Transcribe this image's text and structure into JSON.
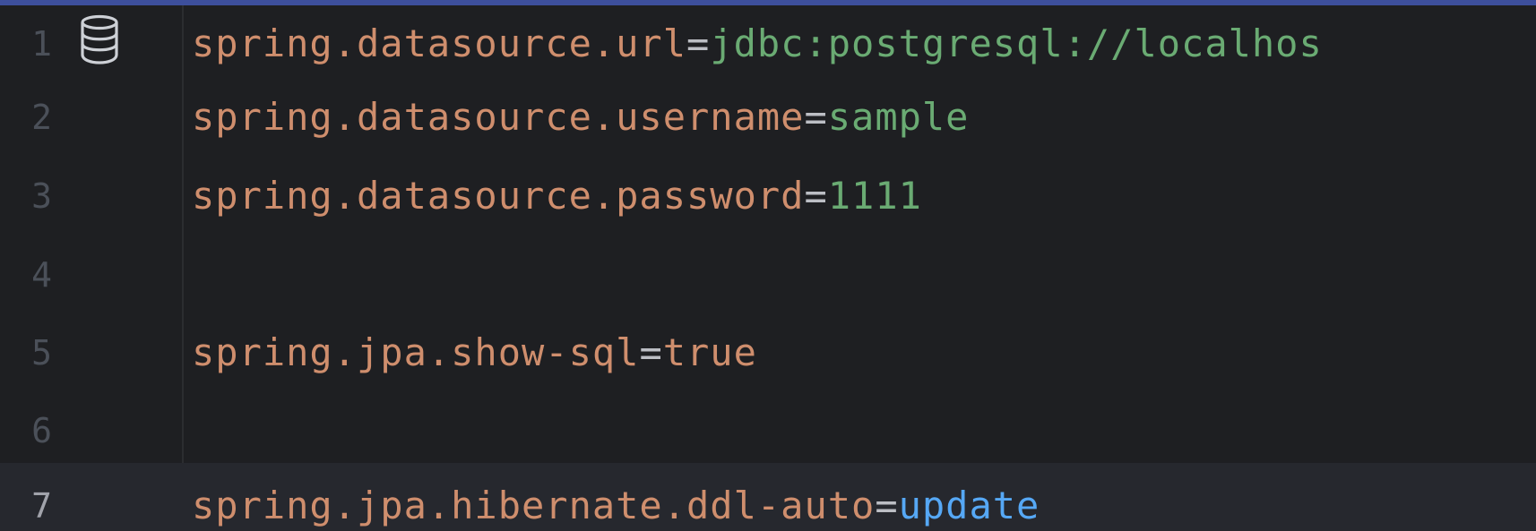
{
  "editor": {
    "lines": [
      {
        "number": "1",
        "key": "spring.datasource.url",
        "separator": "=",
        "value": "jdbc:postgresql://localhos"
      },
      {
        "number": "2",
        "key": "spring.datasource.username",
        "separator": "=",
        "value": "sample"
      },
      {
        "number": "3",
        "key": "spring.datasource.password",
        "separator": "=",
        "value": "1111"
      },
      {
        "number": "4",
        "key": "",
        "separator": "",
        "value": ""
      },
      {
        "number": "5",
        "key": "spring.jpa.show-sql",
        "separator": "=",
        "value": "true"
      },
      {
        "number": "6",
        "key": "",
        "separator": "",
        "value": ""
      },
      {
        "number": "7",
        "key": "spring.jpa.hibernate.ddl-auto",
        "separator": "=",
        "value": "update"
      }
    ],
    "current_line": "7",
    "gutter_icon": "database-icon"
  },
  "colors": {
    "background": "#1e1f22",
    "current_line_background": "#26282e",
    "accent_bar": "#3d4f9c",
    "property_key": "#cf8e6d",
    "separator": "#bcbec4",
    "string_value": "#6aab73",
    "keyword_value": "#56a8f5",
    "line_number": "#4b5059",
    "current_line_number": "#a1a3ab"
  }
}
